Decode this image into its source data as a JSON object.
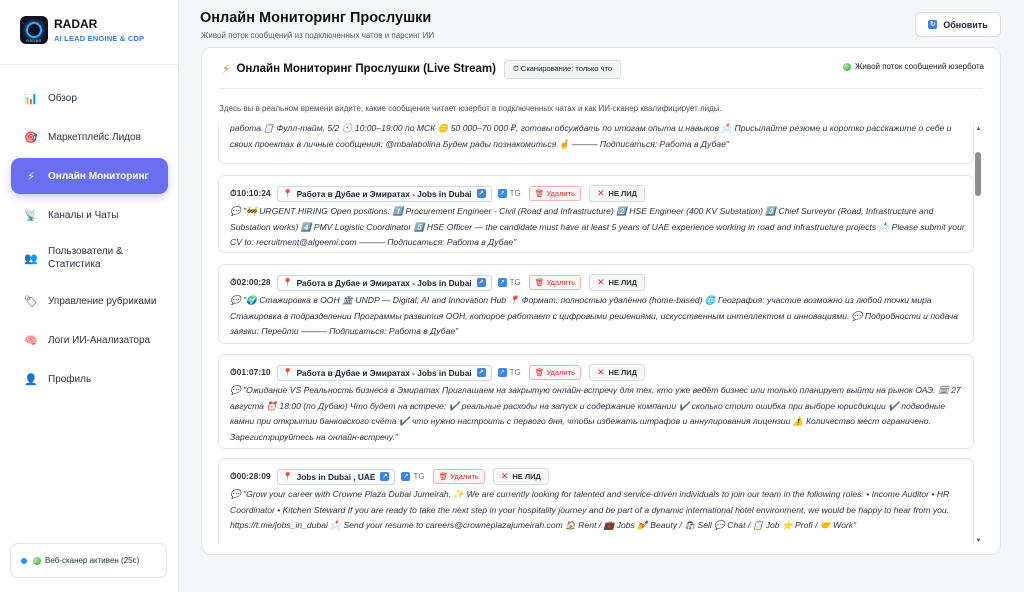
{
  "brand": {
    "title": "RADAR",
    "subtitle": "AI LEAD ENGINE & CDP",
    "logo_text": "RADAR"
  },
  "sidebar": {
    "items": [
      {
        "label": "Обзор",
        "icon": "bar-chart-icon",
        "glyph": "📊"
      },
      {
        "label": "Маркетплейс Лидов",
        "icon": "target-icon",
        "glyph": "🎯"
      },
      {
        "label": "Онлайн Мониторинг",
        "icon": "lightning-icon",
        "glyph": "⚡",
        "active": true
      },
      {
        "label": "Каналы и Чаты",
        "icon": "satellite-icon",
        "glyph": "📡"
      },
      {
        "label": "Пользователи & Статистика",
        "icon": "users-icon",
        "glyph": "👥"
      },
      {
        "label": "Управление рубриками",
        "icon": "tag-icon",
        "glyph": "🏷"
      },
      {
        "label": "Логи ИИ-Анализатора",
        "icon": "brain-icon",
        "glyph": "🧠"
      },
      {
        "label": "Профиль",
        "icon": "person-icon",
        "glyph": "👤"
      }
    ],
    "scanner_status": "Веб-сканер активен (25с)"
  },
  "header": {
    "title": "Онлайн Мониторинг Прослушки",
    "subtitle": "Живой поток сообщений из подключенных чатов и парсинг ИИ",
    "refresh_label": "Обновить"
  },
  "panel": {
    "title": "Онлайн Мониторинг Прослушки (Live Stream)",
    "scan_badge": "⏱ Сканирование: только что",
    "live_label": "Живой поток сообщений юзербота",
    "description": "Здесь вы в реальном времени видите, какие сообщения читает юзербот в подключенных чатах и как ИИ-сканер квалифицирует лиды."
  },
  "labels": {
    "tg": "TG",
    "delete": "Удалить",
    "not_lead": "НЕ ЛИД"
  },
  "partial_message": "работа 📋 Фулл-тайм, 5/2 🕙 10:00–19:00 по МСК 🪙 50 000–70 000 ₽, готовы обсуждать по итогам опыта и навыков 📩 Присылайте резюме и коротко расскажите о себе и своих проектах в личные сообщения: @mbalabolina Будем рады познакомиться 🤞 ——— Подписаться: Работа в Дубае\"",
  "messages": [
    {
      "time": "⏱10:10:24",
      "channel": "Работа в Дубае и Эмиратах - Jobs in Dubai",
      "text": "💬 \"🚧 URGENT HIRING Open positions: 1️⃣ Procurement Engineer - Civil (Road and Infrastructure) 2️⃣ HSE Engineer (400 KV Substation) 3️⃣ Chief Surveyor (Road, Infrastructure and Substation works) 4️⃣ PMV Logistic Coordinator 5️⃣ HSE Officer — the candidate must have at least 5 years of UAE experience working in road and infrastructure projects 📩 Please submit your CV to: recruitment@algeemi.com ——— Подписаться: Работа в Дубае\""
    },
    {
      "time": "⏱02:00:28",
      "channel": "Работа в Дубае и Эмиратах - Jobs in Dubai",
      "text": "💬 \"🌍 Стажировка в ООН 🏛 UNDP — Digital, AI and Innovation Hub 📍 Формат: полностью удалённо (home-based) 🌐 География: участие возможно из любой точки мира Стажировка в подразделении Программы развития ООН, которое работает с цифровыми решениями, искусственным интеллектом и инновациями. 💬 Подробности и подача заявки: Перейти ——— Подписаться: Работа в Дубае\""
    },
    {
      "time": "⏱01:07:10",
      "channel": "Работа в Дубае и Эмиратах - Jobs in Dubai",
      "text": "💬 \"Ожидание VS Реальность бизнеса в Эмиратах Приглашаем на закрытую онлайн-встречу для тех, кто уже ведёт бизнес или только планирует выйти на рынок ОАЭ. 🗓 27 августа ⏰ 18:00 (по Дубаю) Что будет на встрече: ✔️ реальные расходы на запуск и содержание компании ✔️ сколько стоит ошибка при выборе юрисдикции ✔️ подводные камни при открытии банковского счёта ✔️ что нужно настроить с первого дня, чтобы избежать штрафов и аннулирования лицензии ⚠️ Количество мест ограничено. Зарегистрируйтесь на онлайн-встречу.\""
    },
    {
      "time": "⏱00:28:09",
      "channel": "Jobs in Dubai , UAE",
      "text": "💬 \"Grow your career with Crowne Plaza Dubai Jumeirah. ✨ We are currently looking for talented and service-driven individuals to join our team in the following roles: • Income Auditor • HR Coordinator • Kitchen Steward If you are ready to take the next step in your hospitality journey and be part of a dynamic international hotel environment, we would be happy to hear from you. https://t.me/jobs_in_dubai 📩 Send your resume to careers@crowneplazajumeirah.com 🏠 Rent / 💼 Jobs 💅 Beauty / 🛍 Sell 💬 Chat / 📋 Job ⭐ Profi / 🤝 Work\""
    }
  ]
}
